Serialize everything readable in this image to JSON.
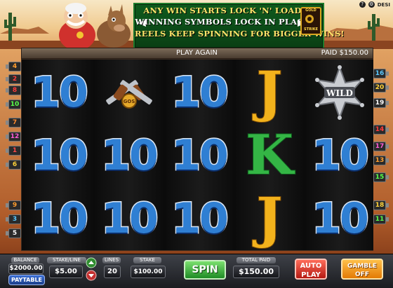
{
  "banner": {
    "line1": "ANY WIN STARTS LOCK 'N' LOAD",
    "line2": "WINNING SYMBOLS LOCK IN PLACE",
    "line3": "REELS KEEP SPINNING FOR BIGGER WINS!",
    "logo_top": "GOLD",
    "logo_bottom": "STRIKE"
  },
  "window_controls": {
    "help": "?",
    "settings": "DESI"
  },
  "status": {
    "message": "PLAY AGAIN",
    "paid": "PAID $150.00"
  },
  "reels": [
    [
      "10",
      "10",
      "10"
    ],
    [
      "pistols",
      "10",
      "10"
    ],
    [
      "10",
      "10",
      "10"
    ],
    [
      "J",
      "K",
      "J"
    ],
    [
      "WILD",
      "10",
      "10"
    ]
  ],
  "wild_label": "WILD",
  "pistol_badge": "GOS",
  "paylines": {
    "left": [
      {
        "n": "4",
        "color": "#ff9d2e"
      },
      {
        "n": "2",
        "color": "#ff3b3b"
      },
      {
        "n": "8",
        "color": "#ff3b3b"
      },
      {
        "n": "10",
        "color": "#58ff4a"
      },
      {
        "n": "7",
        "color": "#ff8a2e"
      },
      {
        "n": "12",
        "color": "#ff5ad8"
      },
      {
        "n": "1",
        "color": "#ff4a4a"
      },
      {
        "n": "6",
        "color": "#ffd23a"
      },
      {
        "n": "9",
        "color": "#ff9d2e"
      },
      {
        "n": "3",
        "color": "#5ac8ff"
      },
      {
        "n": "5",
        "color": "#ffffff"
      }
    ],
    "right": [
      {
        "n": "16",
        "color": "#5ac8ff"
      },
      {
        "n": "20",
        "color": "#ffd23a"
      },
      {
        "n": "19",
        "color": "#ffffff"
      },
      {
        "n": "14",
        "color": "#ff3b3b"
      },
      {
        "n": "17",
        "color": "#ff5ad8"
      },
      {
        "n": "13",
        "color": "#ff9d2e"
      },
      {
        "n": "15",
        "color": "#58ff4a"
      },
      {
        "n": "18",
        "color": "#ffd23a"
      },
      {
        "n": "11",
        "color": "#58ff4a"
      }
    ]
  },
  "panel": {
    "balance_label": "BALANCE",
    "balance": "$2000.00",
    "paytable": "PAYTABLE",
    "stake_line_label": "STAKE/LINE",
    "stake_line": "$5.00",
    "lines_label": "LINES",
    "lines": "20",
    "stake_label": "STAKE",
    "stake": "$100.00",
    "spin": "SPIN",
    "total_paid_label": "TOTAL PAID",
    "total_paid": "$150.00",
    "autoplay_line1": "AUTO",
    "autoplay_line2": "PLAY",
    "gamble_line1": "GAMBLE",
    "gamble_line2": "OFF"
  },
  "colors": {
    "banner_green": "#0f5a1d",
    "ten_blue": "#2f7fd3",
    "jack_gold": "#f2b21c",
    "king_green": "#34b545",
    "spin_green": "#2fb43a",
    "autoplay_red": "#d42a1e",
    "gamble_orange": "#f08a10"
  }
}
